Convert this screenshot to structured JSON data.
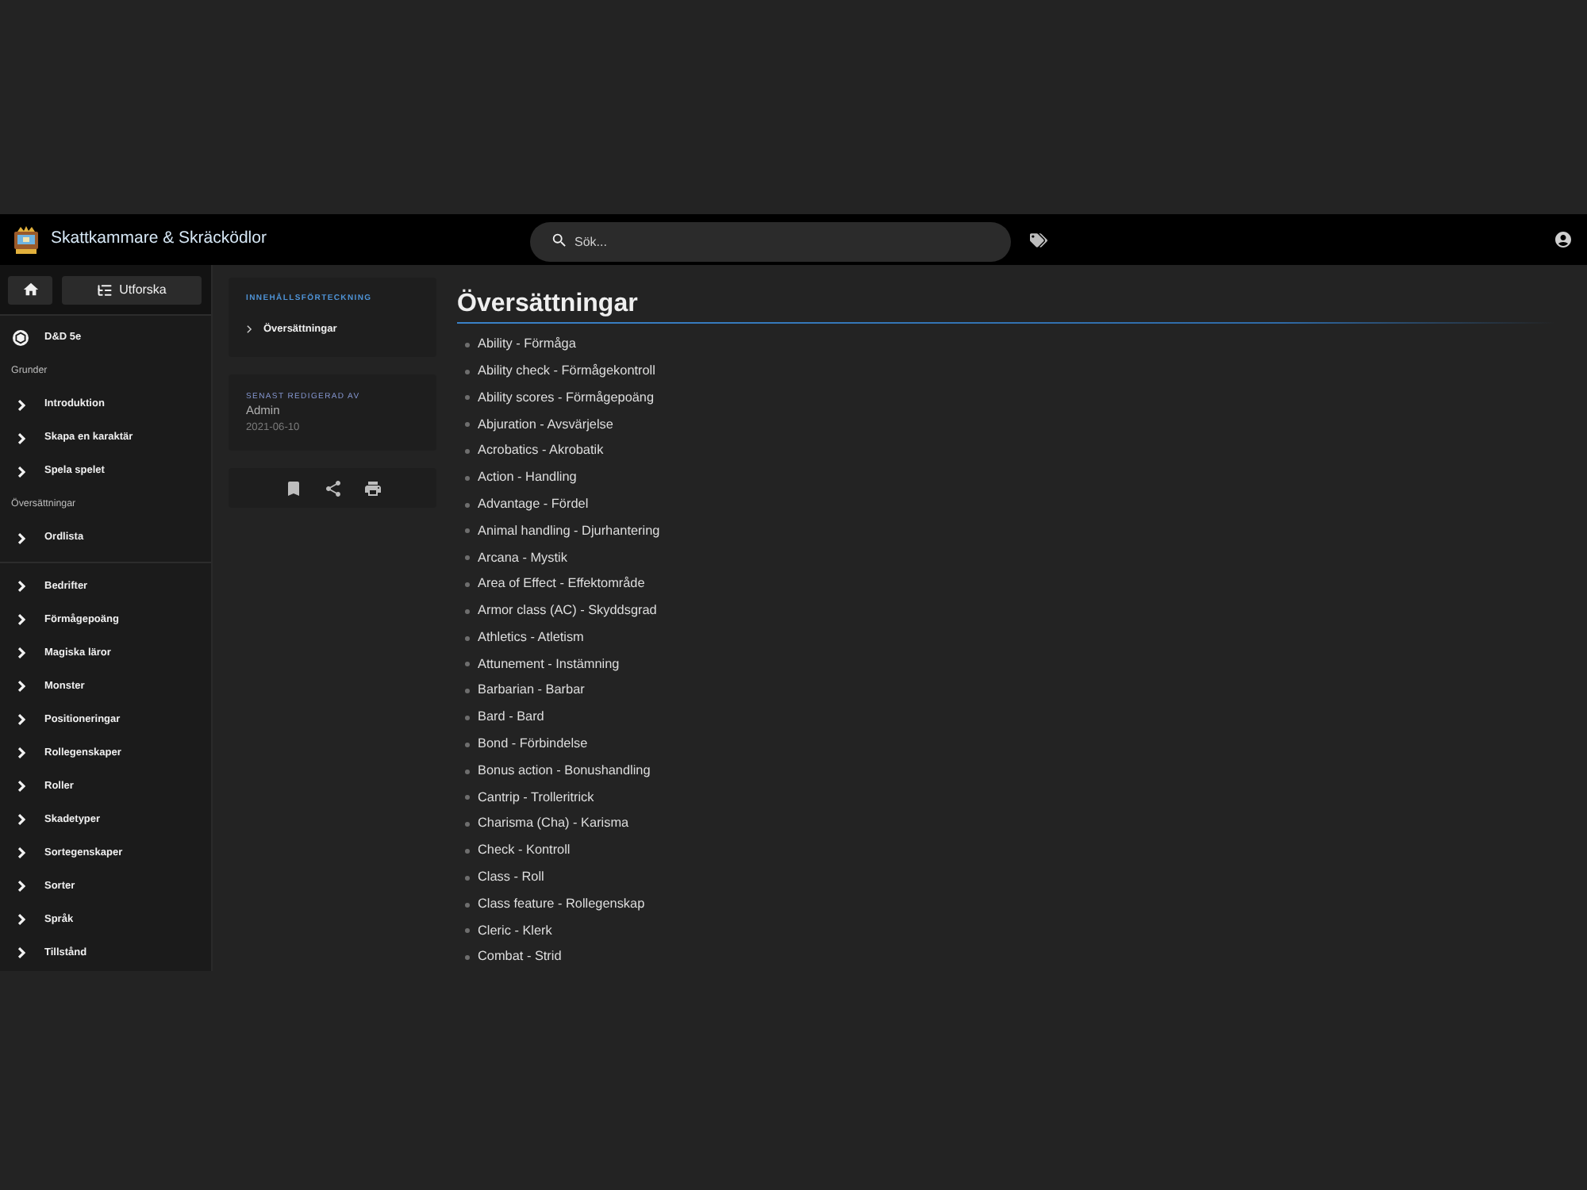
{
  "header": {
    "site_title": "Skattkammare & Skräcködlor",
    "search": {
      "placeholder": "Sök..."
    }
  },
  "sidebar": {
    "explore_button": "Utforska",
    "book": "D&D 5e",
    "sections": [
      {
        "heading": "Grunder",
        "items": [
          "Introduktion",
          "Skapa en karaktär",
          "Spela spelet"
        ]
      },
      {
        "heading": "Översättningar",
        "items": [
          "Ordlista"
        ]
      }
    ],
    "categories": [
      "Bedrifter",
      "Förmågepoäng",
      "Magiska läror",
      "Monster",
      "Positioneringar",
      "Rollegenskaper",
      "Roller",
      "Skadetyper",
      "Sortegenskaper",
      "Sorter",
      "Språk",
      "Tillstånd"
    ]
  },
  "toc": {
    "heading": "INNEHÅLLSFÖRTECKNING",
    "items": [
      "Översättningar"
    ]
  },
  "last_edited": {
    "heading": "SENAST REDIGERAD AV",
    "author": "Admin",
    "date": "2021-06-10"
  },
  "article": {
    "title": "Översättningar",
    "entries": [
      "Ability - Förmåga",
      "Ability check - Förmågekontroll",
      "Ability scores - Förmågepoäng",
      "Abjuration - Avsvärjelse",
      "Acrobatics - Akrobatik",
      "Action - Handling",
      "Advantage - Fördel",
      "Animal handling - Djurhantering",
      "Arcana - Mystik",
      "Area of Effect - Effektområde",
      "Armor class (AC) - Skyddsgrad",
      "Athletics - Atletism",
      "Attunement - Instämning",
      "Barbarian - Barbar",
      "Bard - Bard",
      "Bond - Förbindelse",
      "Bonus action - Bonushandling",
      "Cantrip - Trolleritrick",
      "Charisma (Cha) - Karisma",
      "Check - Kontroll",
      "Class - Roll",
      "Class feature - Rollegenskap",
      "Cleric - Klerk",
      "Combat - Strid"
    ]
  }
}
